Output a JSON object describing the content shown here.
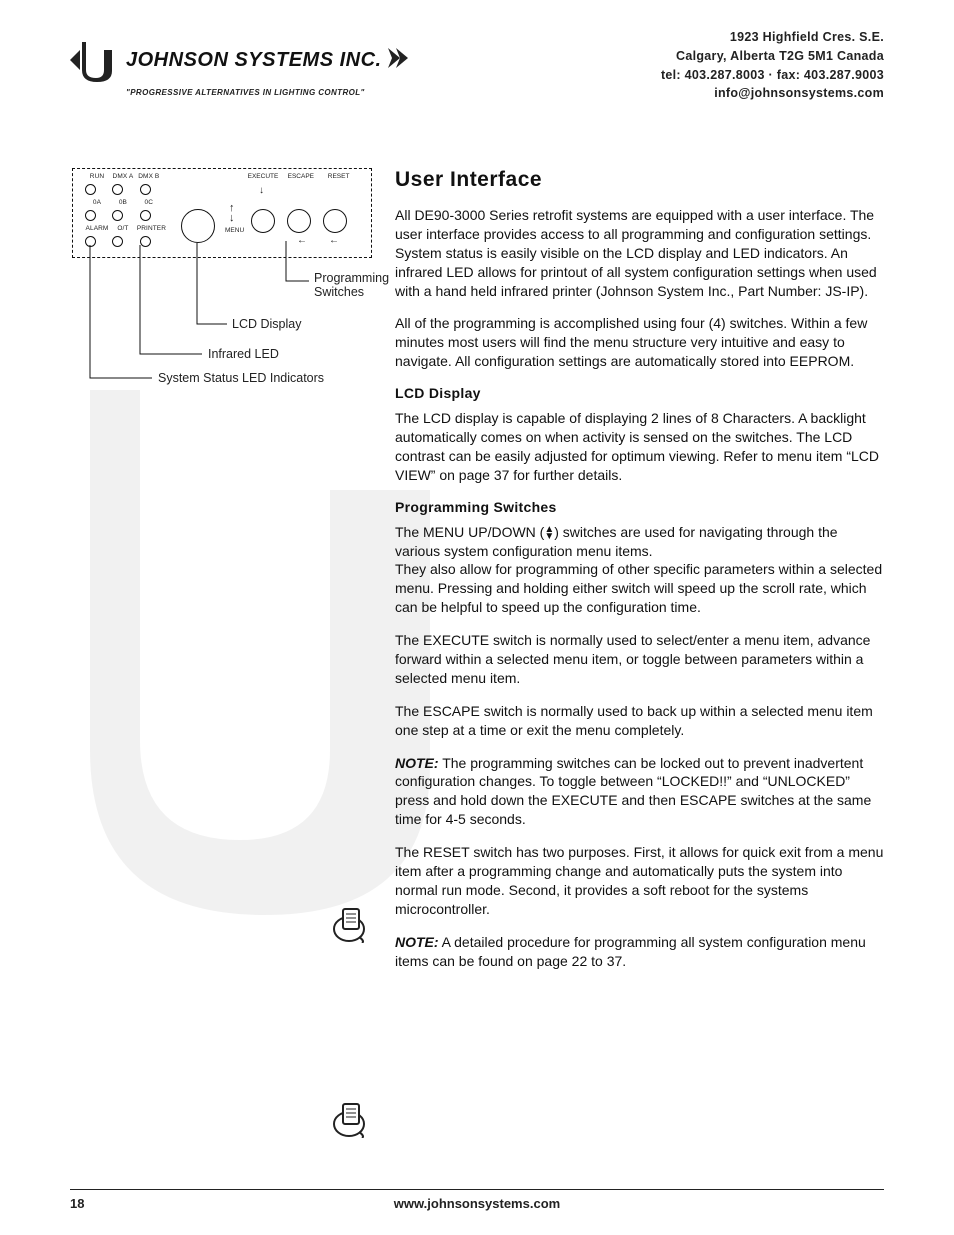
{
  "header": {
    "company_name": "JOHNSON SYSTEMS INC.",
    "tagline": "\"PROGRESSIVE ALTERNATIVES IN LIGHTING CONTROL\"",
    "contact": {
      "line1": "1923 Highfield Cres. S.E.",
      "line2": "Calgary, Alberta  T2G 5M1 Canada",
      "line3": "tel: 403.287.8003 · fax: 403.287.9003",
      "line4": "info@johnsonsystems.com"
    }
  },
  "diagram": {
    "led_row1": [
      "RUN",
      "DMX A",
      "DMX B"
    ],
    "led_row2": [
      "0A",
      "0B",
      "0C"
    ],
    "led_row3": [
      "ALARM",
      "O/T",
      "PRINTER"
    ],
    "menu_label": "MENU",
    "buttons": [
      "EXECUTE",
      "ESCAPE",
      "RESET"
    ],
    "callouts": {
      "programming_switches_l1": "Programming",
      "programming_switches_l2": "Switches",
      "lcd": "LCD Display",
      "ir_led": "Infrared LED",
      "status": "System Status LED Indicators"
    }
  },
  "section": {
    "title": "User Interface",
    "p1": "All DE90-3000 Series retrofit systems are equipped with a user interface. The user interface provides access to all programming and configuration settings. System status is easily visible on the LCD display and LED indicators. An infrared LED allows for printout of all system configuration settings when used with a hand held infrared printer (Johnson System Inc., Part Number: JS-IP).",
    "p2": "All of the programming is accomplished using four (4) switches. Within a few minutes most users will find the menu structure very intuitive and easy to navigate. All configuration settings are automatically stored into EEPROM.",
    "lcd_heading": "LCD Display",
    "lcd_p": "The LCD display is capable of displaying 2 lines of 8 Characters. A backlight automatically comes on when activity is sensed on the switches. The LCD contrast can be easily adjusted for optimum viewing. Refer to menu item “LCD VIEW” on page 37 for further details.",
    "prog_heading": "Programming Switches",
    "prog_p1a": "The MENU UP/DOWN (",
    "prog_p1b": ") switches are used for navigating through the various system configuration menu items.",
    "prog_p1c": "They also allow for programming of other specific parameters within a selected menu. Pressing and holding either switch will speed up the scroll rate, which can be helpful to speed up the configuration time.",
    "prog_p2": "The EXECUTE switch is normally used to select/enter a menu item, advance forward within a selected menu item, or toggle between parameters within a selected menu item.",
    "prog_p3": "The ESCAPE switch is normally used to back up within a selected menu item one step at a time or exit the menu completely.",
    "note1_prefix": "NOTE:",
    "note1": " The programming switches can be locked out to prevent inadvertent configuration changes. To toggle between “LOCKED!!” and “UNLOCKED” press and hold down the EXECUTE and then ESCAPE switches at the same time for 4-5 seconds.",
    "reset_p": "The RESET switch has two purposes. First, it allows for quick exit from a menu item after a programming change and automatically puts the system into normal run mode. Second, it provides a soft reboot for the systems microcontroller.",
    "note2_prefix": "NOTE:",
    "note2": " A detailed procedure for programming all system configuration menu items can be found on page 22 to 37."
  },
  "footer": {
    "page": "18",
    "url": "www.johnsonsystems.com"
  }
}
